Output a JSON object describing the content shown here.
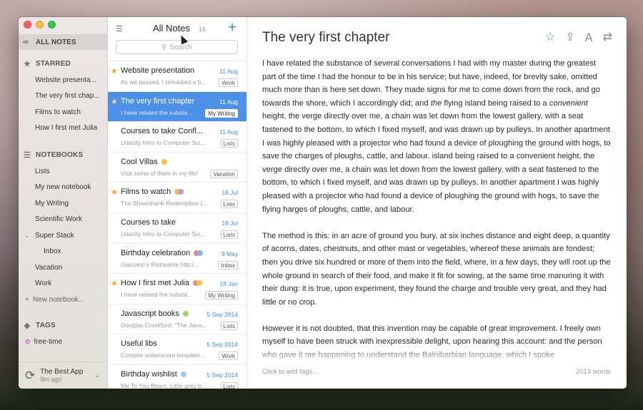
{
  "sidebar": {
    "all_notes": "ALL NOTES",
    "starred_header": "STARRED",
    "starred": [
      "Website presenta...",
      "The very first chap...",
      "Films to watch",
      "How I first met Julia"
    ],
    "notebooks_header": "NOTEBOOKS",
    "notebooks": [
      "Lists",
      "My new notebook",
      "My Writing",
      "Scientific Work"
    ],
    "stack": {
      "name": "Super Stack",
      "child": "Inbox"
    },
    "notebooks_more": [
      "Vacation",
      "Work"
    ],
    "new_notebook": "New notebook...",
    "tags_header": "TAGS",
    "tags": [
      "free-time"
    ],
    "sync": {
      "name": "The Best App",
      "ago": "9m ago"
    }
  },
  "notelist": {
    "title": "All Notes",
    "count": "16",
    "search_placeholder": "Search",
    "notes": [
      {
        "title": "Website presentation",
        "date": "11 Aug",
        "preview": "As we passed, I remarked a b...",
        "notebook": "Work",
        "starred": true,
        "selected": false,
        "dots": []
      },
      {
        "title": "The very first chapter",
        "date": "11 Aug",
        "preview": "I have related the substa...",
        "notebook": "My Writing",
        "starred": true,
        "selected": true,
        "dots": []
      },
      {
        "title": "Courses to take Confl...",
        "date": "11 Aug",
        "preview": "Udacity Intro to Computer Sci...",
        "notebook": "Lists",
        "starred": false,
        "selected": false,
        "dots": [
          "#f08a7a"
        ]
      },
      {
        "title": "Cool Villas",
        "date": "",
        "preview": "Visit some of them in my life!",
        "notebook": "Vacation",
        "starred": false,
        "selected": false,
        "dots": [
          "#f5c242"
        ]
      },
      {
        "title": "Films to watch",
        "date": "18 Jul",
        "preview": "The Shawshank Redemption (...",
        "notebook": "Lists",
        "starred": true,
        "selected": false,
        "dots": [
          "#f5c242",
          "#c38ef0"
        ]
      },
      {
        "title": "Courses to take",
        "date": "18 Jul",
        "preview": "Udacity Intro to Computer Sci...",
        "notebook": "Lists",
        "starred": false,
        "selected": false,
        "dots": []
      },
      {
        "title": "Birthday celebration",
        "date": "9 May",
        "preview": "Giacomo's Ristorante http:/...",
        "notebook": "Inbox",
        "starred": false,
        "selected": false,
        "dots": [
          "#f08a7a",
          "#7fb6f0"
        ]
      },
      {
        "title": "How I first met Julia",
        "date": "18 Jan",
        "preview": "I have related the substa...",
        "notebook": "My Writing",
        "starred": true,
        "selected": false,
        "dots": [
          "#f08a7a",
          "#f5c242"
        ]
      },
      {
        "title": "Javascript books",
        "date": "5 Sep 2014",
        "preview": "Douglas Crockford: \"The Java...",
        "notebook": "Lists",
        "starred": false,
        "selected": false,
        "dots": [
          "#a6d46a"
        ]
      },
      {
        "title": "Useful libs",
        "date": "5 Sep 2014",
        "preview": "Compile underscore template...",
        "notebook": "Work",
        "starred": false,
        "selected": false,
        "dots": []
      },
      {
        "title": "Birthday wishlist",
        "date": "5 Sep 2014",
        "preview": "Me To You Bears. Little grey b...",
        "notebook": "Lists",
        "starred": false,
        "selected": false,
        "dots": [
          "#9cc8f0"
        ]
      }
    ]
  },
  "editor": {
    "title": "The very first chapter",
    "paragraphs": [
      [
        {
          "t": "I have related the substance of several conversations I had with my master during the greatest part of the time I had the honour to be in his service; but have, indeed, for brevity sake, omitted much more than is here set down. They made signs for me to come down from the rock, and go towards the shore, which I accordingly did; and "
        },
        {
          "t": "the",
          "i": true
        },
        {
          "t": " flying island being raised to a "
        },
        {
          "t": "convenient",
          "i": true
        },
        {
          "t": " height, the verge directly over me, a chain was let down from the lowest gallery, with a seat fastened to the bottom, to which I fixed myself, and was drawn up by pulleys. In another apartment I was highly pleased with a projector who had found a device of ploughing the ground with hogs, to save the charges of ploughs, cattle, and labour. island being raised to a convenient height, the verge directly over me, a chain was let down from the lowest gallery, with a seat fastened to the bottom, to which I fixed myself, and was drawn up by pulleys. In another apartment I was highly pleased with a projector who had found a device of ploughing the ground with hogs, to save the flying harges of ploughs, cattle, and labour."
        }
      ],
      [
        {
          "t": "The method is this: in an acre of ground you bury, at six inches distance and eight deep, a quantity of acorns, dates, chestnuts, and other mast or vegetables, whereof these animals are fondest; then you drive six hundred or more of them into the field, where, in a few days, they will root up the whole ground in search of their food, and make it fit for sowing, at the same time manuring it with their dung: it is true, upon experiment, they found the charge and trouble very great, and they had little or no crop."
        }
      ],
      [
        {
          "t": "However it is not doubted, that this invention may be capable of great improvement. I freely own myself to have been struck with inexpressible delight, upon hearing this account: and the person who gave it me happening to understand the Balnibarbian language, which I spoke"
        }
      ]
    ],
    "footer_left": "Click to add tags...",
    "footer_right": "2013 words"
  },
  "colors": {
    "accent": "#3b8ded",
    "selection": "#4d90e8",
    "star": "#f5a623"
  },
  "icons": [
    "infinity-icon",
    "star-icon",
    "notebook-icon",
    "tag-icon",
    "sync-icon",
    "sort-icon",
    "plus-icon",
    "search-icon",
    "share-icon",
    "font-icon",
    "present-icon"
  ]
}
